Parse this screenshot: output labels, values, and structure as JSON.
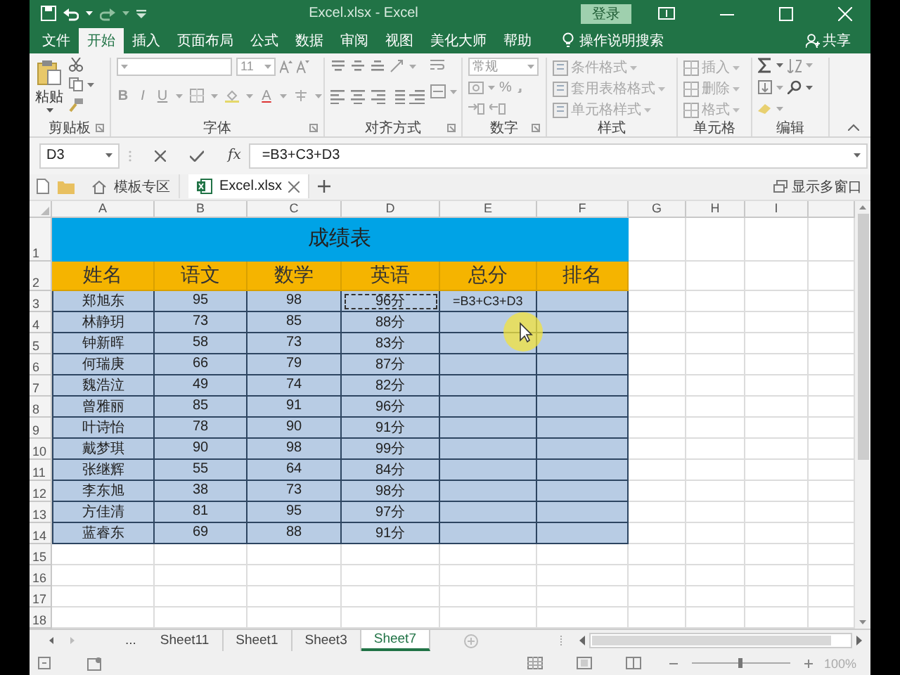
{
  "title_bar": {
    "title": "Excel.xlsx - Excel",
    "login": "登录"
  },
  "ribbon": {
    "tabs": [
      {
        "label": "文件",
        "selected": false
      },
      {
        "label": "开始",
        "selected": true
      },
      {
        "label": "插入",
        "selected": false
      },
      {
        "label": "页面布局",
        "selected": false
      },
      {
        "label": "公式",
        "selected": false
      },
      {
        "label": "数据",
        "selected": false
      },
      {
        "label": "审阅",
        "selected": false
      },
      {
        "label": "视图",
        "selected": false
      },
      {
        "label": "美化大师",
        "selected": false
      },
      {
        "label": "帮助",
        "selected": false
      }
    ],
    "search": "操作说明搜索",
    "share": "共享",
    "groups": [
      {
        "kind": "clipboard",
        "label": "剪贴板",
        "paste": "粘贴"
      },
      {
        "kind": "font",
        "label": "字体",
        "size": "11",
        "formats": [
          {
            "kind": "bold",
            "label": "B"
          },
          {
            "kind": "italic",
            "label": "I"
          },
          {
            "kind": "underline",
            "label": "U"
          }
        ],
        "font_color": "A"
      },
      {
        "kind": "alignment",
        "label": "对齐方式"
      },
      {
        "kind": "number",
        "label": "数字",
        "format": "常规",
        "percent": "%"
      },
      {
        "kind": "styles",
        "label": "样式",
        "items": [
          {
            "label": "条件格式",
            "disabled": true
          },
          {
            "label": "套用表格格式",
            "disabled": true
          },
          {
            "label": "单元格样式",
            "disabled": true
          }
        ]
      },
      {
        "kind": "cells",
        "label": "单元格",
        "items": [
          {
            "label": "插入",
            "disabled": true
          },
          {
            "label": "删除",
            "disabled": true
          },
          {
            "label": "格式",
            "disabled": true
          }
        ]
      },
      {
        "kind": "editing",
        "label": "编辑"
      }
    ]
  },
  "formula_bar": {
    "name_box": "D3",
    "function_button": "fx",
    "formula": "=B3+C3+D3"
  },
  "doc_tabs": {
    "items": [
      {
        "kind": "home",
        "label": "模板专区",
        "selected": false
      },
      {
        "kind": "file",
        "label": "Excel.xlsx",
        "selected": true
      }
    ],
    "multi_window": "显示多窗口"
  },
  "sheet": {
    "columns": [
      "A",
      "B",
      "C",
      "D",
      "E",
      "F",
      "G",
      "H",
      "I"
    ],
    "row_numbers": [
      "1",
      "2",
      "3",
      "4",
      "5",
      "6",
      "7",
      "8",
      "9",
      "10",
      "11",
      "12",
      "13",
      "14",
      "15",
      "16",
      "17",
      "18"
    ],
    "title": "成绩表",
    "headers": [
      "姓名",
      "语文",
      "数学",
      "英语",
      "总分",
      "排名"
    ],
    "rows": [
      {
        "cells": [
          "郑旭东",
          "95",
          "98",
          "96分"
        ],
        "total": "=B3+C3+D3",
        "copy_marked": true
      },
      {
        "cells": [
          "林静玥",
          "73",
          "85",
          "88分"
        ],
        "copy_marked": false
      },
      {
        "cells": [
          "钟新晖",
          "58",
          "73",
          "83分"
        ],
        "copy_marked": false
      },
      {
        "cells": [
          "何瑞庚",
          "66",
          "79",
          "87分"
        ],
        "copy_marked": false
      },
      {
        "cells": [
          "魏浩泣",
          "49",
          "74",
          "82分"
        ],
        "copy_marked": false
      },
      {
        "cells": [
          "曾雅丽",
          "85",
          "91",
          "96分"
        ],
        "copy_marked": false
      },
      {
        "cells": [
          "叶诗怡",
          "78",
          "90",
          "91分"
        ],
        "copy_marked": false
      },
      {
        "cells": [
          "戴梦琪",
          "90",
          "98",
          "99分"
        ],
        "copy_marked": false
      },
      {
        "cells": [
          "张继辉",
          "55",
          "64",
          "84分"
        ],
        "copy_marked": false
      },
      {
        "cells": [
          "李东旭",
          "38",
          "73",
          "98分"
        ],
        "copy_marked": false
      },
      {
        "cells": [
          "方佳清",
          "81",
          "95",
          "97分"
        ],
        "copy_marked": false
      },
      {
        "cells": [
          "蓝睿东",
          "69",
          "88",
          "91分"
        ],
        "copy_marked": false
      }
    ]
  },
  "sheet_tabs": {
    "overflow": "...",
    "tabs": [
      {
        "label": "Sheet11",
        "selected": false
      },
      {
        "label": "Sheet1",
        "selected": false
      },
      {
        "label": "Sheet3",
        "selected": false
      },
      {
        "label": "Sheet7",
        "selected": true
      }
    ]
  },
  "status_bar": {
    "zoom": "100%",
    "zoom_slider": {
      "level": 0.5
    }
  }
}
